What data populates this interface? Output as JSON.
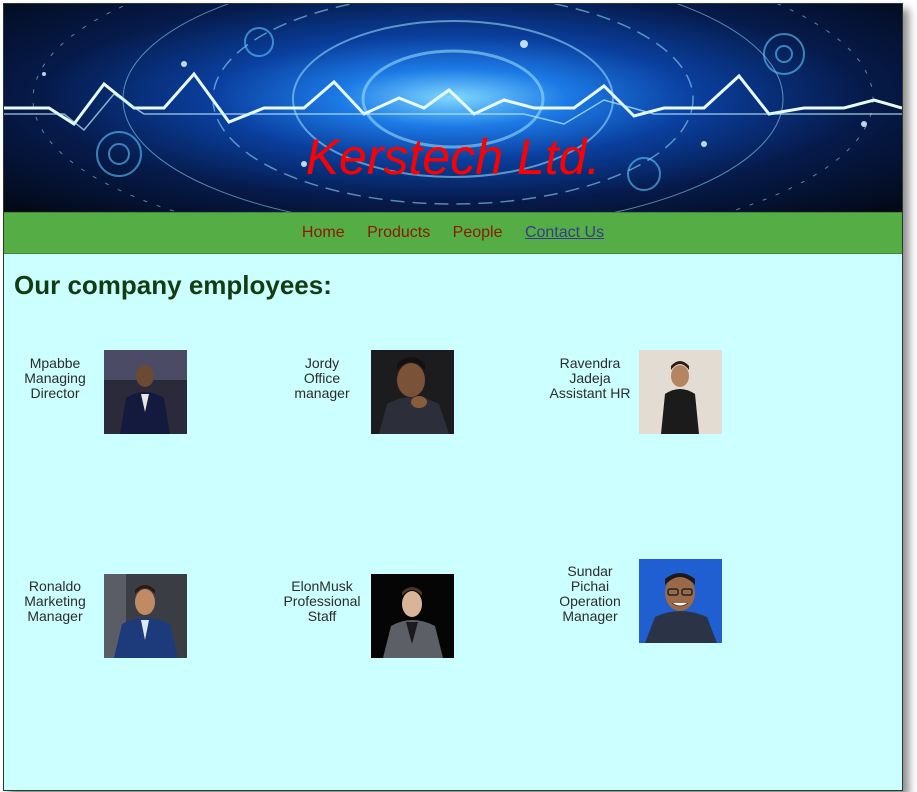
{
  "header": {
    "title": "Kerstech Ltd."
  },
  "nav": {
    "items": [
      {
        "label": "Home"
      },
      {
        "label": "Products"
      },
      {
        "label": "People"
      },
      {
        "label": "Contact Us"
      }
    ]
  },
  "main": {
    "heading": "Our company employees:",
    "employees": [
      {
        "name": "Mpabbe",
        "role_line1": "Managing",
        "role_line2": "Director"
      },
      {
        "name": "Jordy",
        "role_line1": "Office",
        "role_line2": "manager"
      },
      {
        "name": "Ravendra",
        "role_line1": "Jadeja",
        "role_line2": "Assistant HR"
      },
      {
        "name": "Ronaldo",
        "role_line1": "Marketing",
        "role_line2": "Manager"
      },
      {
        "name": "ElonMusk",
        "role_line1": "Professional",
        "role_line2": "Staff"
      },
      {
        "name": "Sundar",
        "role_line1": "Pichai",
        "role_line2": "Operation",
        "role_line3": "Manager"
      }
    ]
  },
  "colors": {
    "page_background": "#ccffff",
    "nav_background": "#55ad46",
    "title_red": "#ff0000",
    "nav_link": "#8b1a00",
    "heading_green": "#123d12"
  }
}
